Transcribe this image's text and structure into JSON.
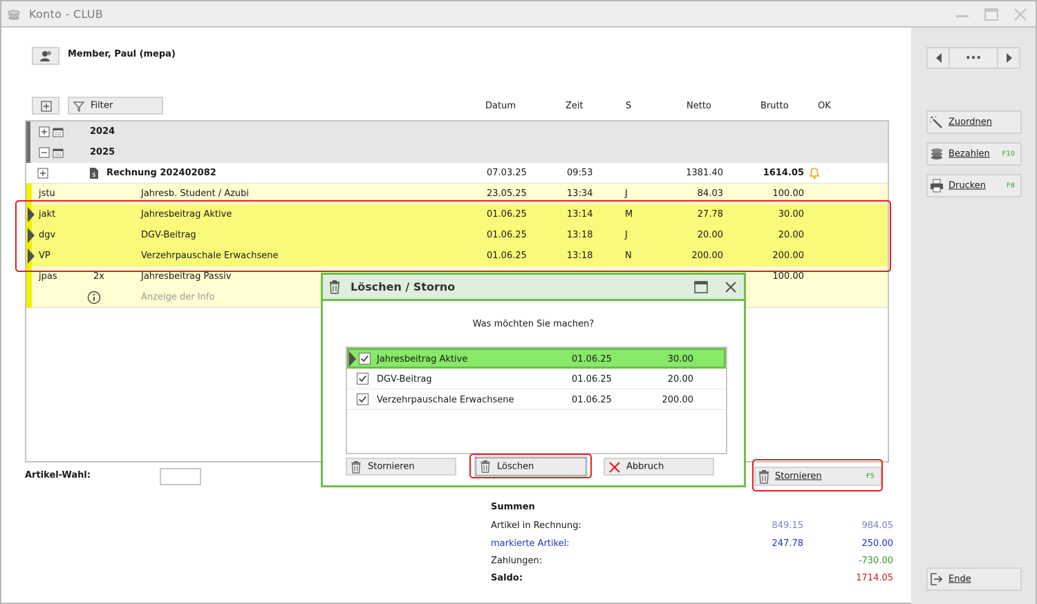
{
  "window": {
    "title": "Konto - CLUB"
  },
  "member": {
    "name": "Member, Paul (mepa)"
  },
  "toolbar": {
    "filter_label": "Filter"
  },
  "columns": {
    "datum": "Datum",
    "zeit": "Zeit",
    "s": "S",
    "netto": "Netto",
    "brutto": "Brutto",
    "ok": "OK"
  },
  "groups": {
    "y2024": "2024",
    "y2025": "2025"
  },
  "invoice": {
    "label": "Rechnung 202402082",
    "datum": "07.03.25",
    "zeit": "09:53",
    "netto": "1381.40",
    "brutto": "1614.05"
  },
  "items": [
    {
      "code": "jstu",
      "qty": "",
      "name": "Jahresb. Student / Azubi",
      "datum": "23.05.25",
      "zeit": "13:34",
      "s": "J",
      "netto": "84.03",
      "brutto": "100.00"
    },
    {
      "code": "jakt",
      "qty": "",
      "name": "Jahresbeitrag Aktive",
      "datum": "01.06.25",
      "zeit": "13:14",
      "s": "M",
      "netto": "27.78",
      "brutto": "30.00"
    },
    {
      "code": "dgv",
      "qty": "",
      "name": "DGV-Beitrag",
      "datum": "01.06.25",
      "zeit": "13:18",
      "s": "J",
      "netto": "20.00",
      "brutto": "20.00"
    },
    {
      "code": "VP",
      "qty": "",
      "name": "Verzehrpauschale Erwachsene",
      "datum": "01.06.25",
      "zeit": "13:18",
      "s": "N",
      "netto": "200.00",
      "brutto": "200.00"
    },
    {
      "code": "jpas",
      "qty": "2x",
      "name": "Jahresbeitrag Passiv",
      "datum": "",
      "zeit": "",
      "s": "",
      "netto": "",
      "brutto": "100.00"
    }
  ],
  "info_row": {
    "label": "Anzeige der Info"
  },
  "artikel_wahl": {
    "label": "Artikel-Wahl:",
    "value": ""
  },
  "dialog": {
    "title": "Löschen / Storno",
    "question": "Was möchten Sie machen?",
    "items": [
      {
        "name": "Jahresbeitrag Aktive",
        "datum": "01.06.25",
        "betrag": "30.00"
      },
      {
        "name": "DGV-Beitrag",
        "datum": "01.06.25",
        "betrag": "20.00"
      },
      {
        "name": "Verzehrpauschale Erwachsene",
        "datum": "01.06.25",
        "betrag": "200.00"
      }
    ],
    "btn_stornieren": "Stornieren",
    "btn_loeschen": "Löschen",
    "btn_abbruch": "Abbruch"
  },
  "main_stornieren": {
    "label": "Stornieren",
    "key": "F5"
  },
  "summen": {
    "title": "Summen",
    "artikel_label": "Artikel in Rechnung:",
    "artikel_netto": "849.15",
    "artikel_brutto": "984.05",
    "markiert_label": "markierte Artikel:",
    "markiert_netto": "247.78",
    "markiert_brutto": "250.00",
    "zahlungen_label": "Zahlungen:",
    "zahlungen_brutto": "-730.00",
    "saldo_label": "Saldo:",
    "saldo_brutto": "1714.05"
  },
  "sidebar": {
    "nav_more": "•••",
    "zuordnen": "Zuordnen",
    "bezahlen": "Bezahlen",
    "bezahlen_key": "F10",
    "drucken": "Drucken",
    "drucken_key": "F8",
    "ende": "Ende"
  },
  "colors": {
    "accent_green": "#6cbf4a",
    "highlight_red": "#e02020",
    "row_yellow": "#fefed2",
    "marked_yellow": "#fafa7a",
    "blue_text": "#2233cc",
    "green_text": "#2a9a2a",
    "red_text": "#cc2222"
  }
}
